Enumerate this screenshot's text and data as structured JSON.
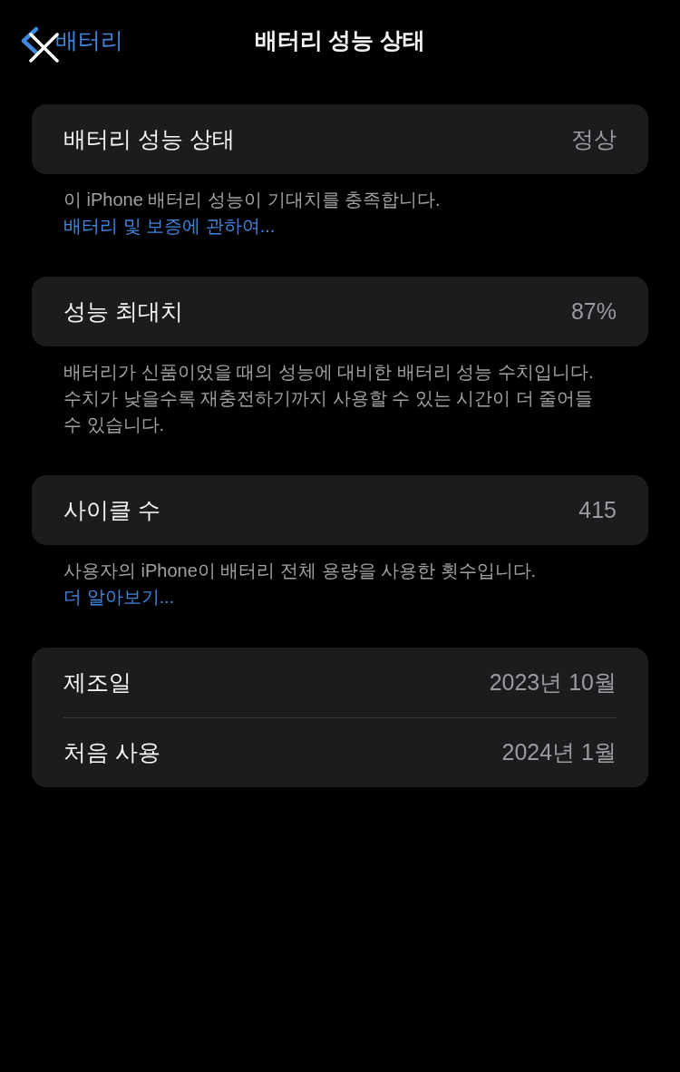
{
  "nav_bar": {
    "back_label": "배터리",
    "title": "배터리 성능 상태"
  },
  "sections": [
    {
      "rows": [
        {
          "label": "배터리 성능 상태",
          "value": "정상"
        }
      ],
      "footer": {
        "text": "이 iPhone 배터리 성능이 기대치를 충족합니다.",
        "link": "배터리 및 보증에 관하여..."
      }
    },
    {
      "rows": [
        {
          "label": "성능 최대치",
          "value": "87%"
        }
      ],
      "footer": {
        "text": "배터리가 신품이었을 때의 성능에 대비한 배터리 성능 수치입니다. 수치가 낮을수록 재충전하기까지 사용할 수 있는 시간이 더 줄어들 수 있습니다."
      }
    },
    {
      "rows": [
        {
          "label": "사이클 수",
          "value": "415"
        }
      ],
      "footer": {
        "text": "사용자의 iPhone이 배터리 전체 용량을 사용한 횟수입니다.",
        "link": "더 알아보기..."
      }
    },
    {
      "rows": [
        {
          "label": "제조일",
          "value": "2023년 10월"
        },
        {
          "label": "처음 사용",
          "value": "2024년 1월"
        }
      ]
    }
  ]
}
